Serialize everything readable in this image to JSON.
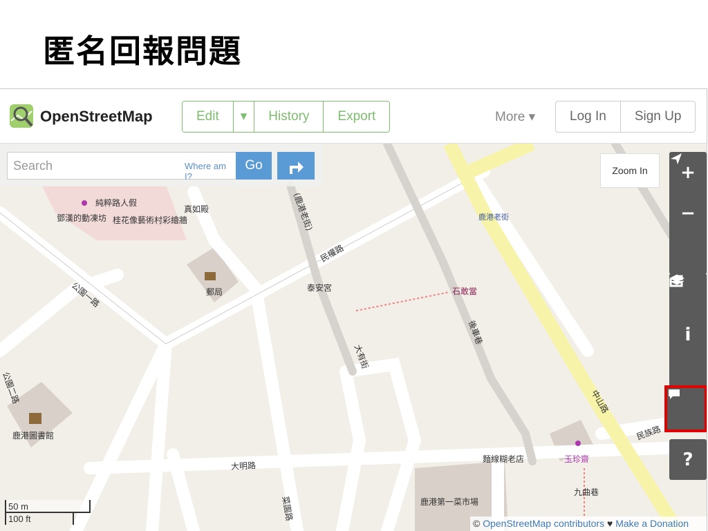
{
  "slide": {
    "title": "匿名回報問題"
  },
  "header": {
    "brand": "OpenStreetMap",
    "nav": {
      "edit": "Edit",
      "dropdown": "▾",
      "history": "History",
      "export": "Export"
    },
    "more": "More ▾",
    "auth": {
      "login": "Log In",
      "signup": "Sign Up"
    }
  },
  "search": {
    "placeholder": "Search",
    "where_am_i": "Where am I?",
    "go": "Go"
  },
  "map": {
    "zoom_in_tooltip": "Zoom In",
    "labels": {
      "chunzui": "純粹路人假",
      "dengjia": "鄧漢的動凍坊",
      "guihua": "桂花像藝術村彩繪牆",
      "zhenrudian": "真如殿",
      "post": "郵局",
      "taian": "泰安宮",
      "minquan": "民權路",
      "gongyuan1": "公園一路",
      "lugang_oldst": "(鹿港老街)",
      "shigandang": "石敢當",
      "lugang_oldst2": "鹿港老街",
      "dayou": "大有街",
      "houche": "後車巷",
      "zhongshan": "中山路",
      "minzu": "民族路",
      "library": "鹿港圖書館",
      "daming": "大明路",
      "noodle": "麵線糊老店",
      "yuzhen": "玉珍齋",
      "jiuqu": "九曲巷",
      "market": "鹿港第一菜市場",
      "caiyuan": "菜園路",
      "gongyuan2": "公園二路"
    },
    "scale": {
      "metric": "50 m",
      "imperial": "100 ft"
    },
    "attribution": {
      "prefix": "© ",
      "osm": "OpenStreetMap contributors",
      "heart": " ♥ ",
      "donate": "Make a Donation"
    }
  },
  "controls": [
    "plus-icon",
    "minus-icon",
    "locate-icon",
    "layers-icon",
    "info-icon",
    "share-icon",
    "note-icon",
    "help-icon"
  ],
  "colors": {
    "accent": "#7ebc6f",
    "go_button": "#5b9bd5",
    "highlight": "#e00000",
    "control_bg": "#5a5a5a"
  }
}
